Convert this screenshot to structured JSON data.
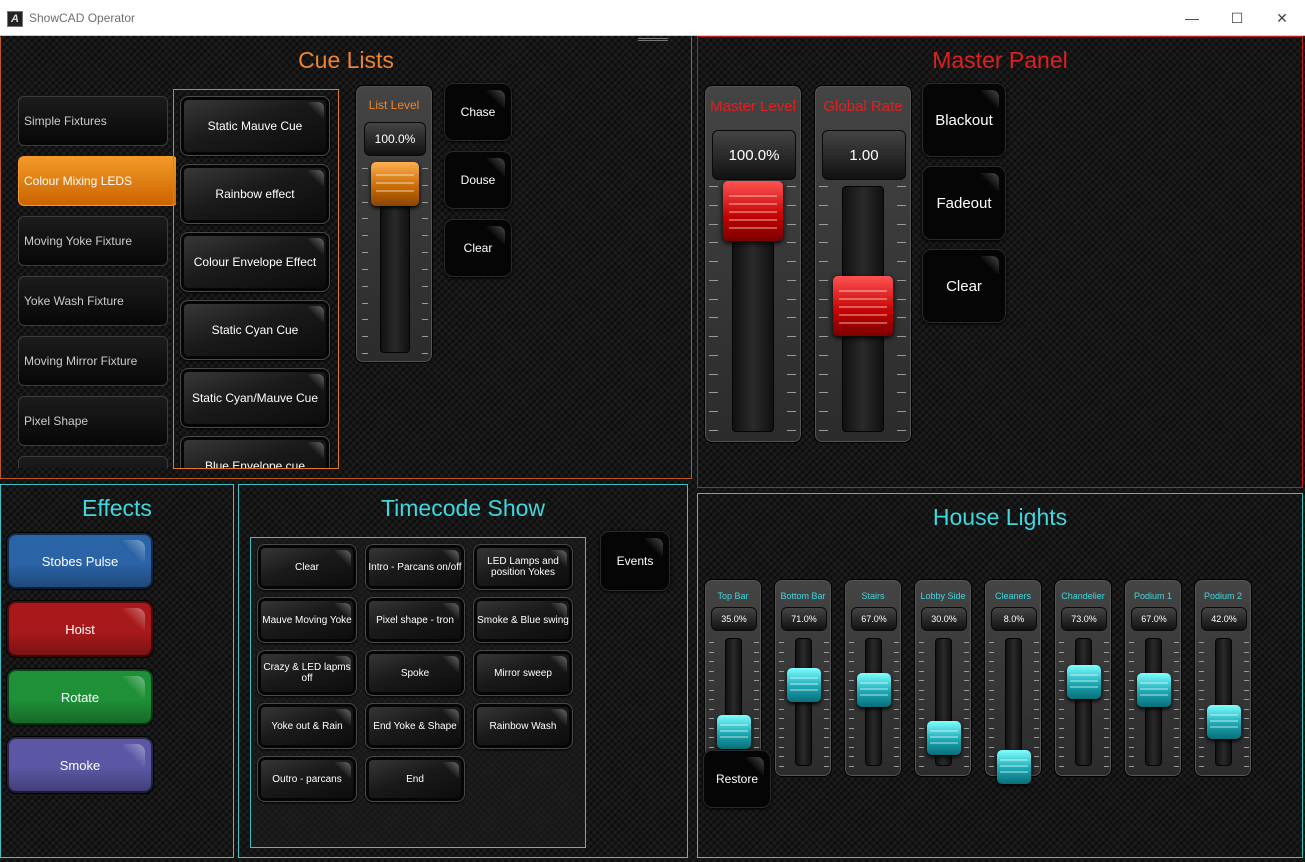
{
  "window": {
    "title": "ShowCAD Operator",
    "controls": [
      "—",
      "☐",
      "✕"
    ]
  },
  "cue_lists": {
    "title": "Cue Lists",
    "lists": [
      "Simple Fixtures",
      "Colour Mixing LEDS",
      "Moving Yoke Fixture",
      "Yoke Wash Fixture",
      "Moving Mirror Fixture",
      "Pixel Shape",
      ""
    ],
    "selected_list": "Colour Mixing LEDS",
    "cues": [
      "Static Mauve Cue",
      "Rainbow effect",
      "Colour Envelope Effect",
      "Static Cyan Cue",
      "Static Cyan/Mauve Cue",
      "Blue Envelope cue"
    ],
    "list_level": {
      "label": "List Level",
      "value": "100.0%",
      "level": 1.0
    },
    "buttons": {
      "chase": "Chase",
      "douse": "Douse",
      "clear": "Clear"
    }
  },
  "master_panel": {
    "title": "Master Panel",
    "faders": [
      {
        "label": "Master Level",
        "value": "100.0%",
        "level": 1.0
      },
      {
        "label": "Global Rate",
        "value": "1.00",
        "level": 0.5
      }
    ],
    "buttons": {
      "blackout": "Blackout",
      "fadeout": "Fadeout",
      "clear": "Clear"
    }
  },
  "effects": {
    "title": "Effects",
    "buttons": [
      {
        "label": "Stobes Pulse",
        "color": "#2a63a6"
      },
      {
        "label": "Hoist",
        "color": "#a8191b"
      },
      {
        "label": "Rotate",
        "color": "#1e9038"
      },
      {
        "label": "Smoke",
        "color": "#5b57a5"
      }
    ]
  },
  "timecode": {
    "title": "Timecode Show",
    "cues": [
      "Clear",
      "Intro - Parcans on/off",
      "LED Lamps and position Yokes",
      "Mauve Moving Yoke",
      "Pixel shape - tron",
      "Smoke & Blue swing",
      "Crazy & LED lapms off",
      "Spoke",
      "Mirror sweep",
      "Yoke out & Rain",
      "End Yoke & Shape",
      "Rainbow Wash",
      "Outro - parcans",
      "End"
    ],
    "events_button": "Events"
  },
  "house_lights": {
    "title": "House Lights",
    "faders": [
      {
        "label": "Top Bar",
        "value": "35.0%",
        "level": 0.35
      },
      {
        "label": "Bottom Bar",
        "value": "71.0%",
        "level": 0.71
      },
      {
        "label": "Stairs",
        "value": "67.0%",
        "level": 0.67
      },
      {
        "label": "Lobby Side",
        "value": "30.0%",
        "level": 0.3
      },
      {
        "label": "Cleaners",
        "value": "8.0%",
        "level": 0.08
      },
      {
        "label": "Chandelier",
        "value": "73.0%",
        "level": 0.73
      },
      {
        "label": "Podium 1",
        "value": "67.0%",
        "level": 0.67
      },
      {
        "label": "Podium 2",
        "value": "42.0%",
        "level": 0.42
      }
    ],
    "restore_button": "Restore"
  },
  "colors": {
    "orange": "#f0842c",
    "red": "#e02020",
    "cyan": "#3fd8e0"
  }
}
